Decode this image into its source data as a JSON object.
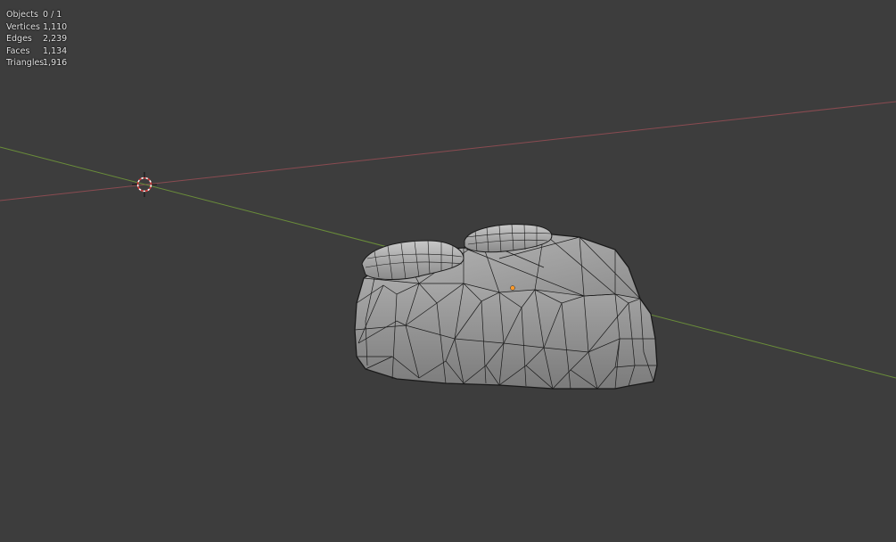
{
  "viewport": {
    "background": "#3d3d3d",
    "x_axis_color": "#8a4b51",
    "y_axis_color": "#6a8d3a",
    "mesh_fill": "#9a9a9a",
    "wire_color": "#1a1a1a",
    "origin_color": "#ff9a2a"
  },
  "stats": {
    "objects": {
      "label": "Objects",
      "value": "0 / 1"
    },
    "vertices": {
      "label": "Vertices",
      "value": "1,110"
    },
    "edges": {
      "label": "Edges",
      "value": "2,239"
    },
    "faces": {
      "label": "Faces",
      "value": "1,134"
    },
    "triangles": {
      "label": "Triangles",
      "value": "1,916"
    }
  },
  "cursor_icon": "3d-cursor-icon"
}
